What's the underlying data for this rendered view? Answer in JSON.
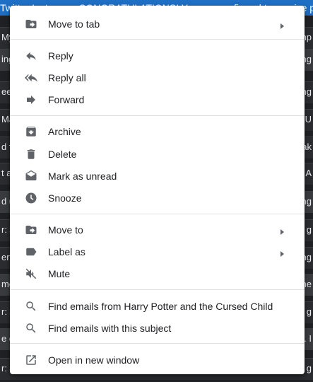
{
  "background": {
    "banner": "Twitter Instagram CONGRATULATIONS! You are confirmed to receive pr",
    "rows": [
      {
        "left": "My",
        "right": "mp"
      },
      {
        "left": "ing",
        "right": "ing"
      },
      {
        "left": "een",
        "right": "ing"
      },
      {
        "left": "Ma",
        "right": "XU"
      },
      {
        "left": "d f",
        "right": "ak"
      },
      {
        "left": "t a",
        "right": "A"
      },
      {
        "left": "d u",
        "right": "ng"
      },
      {
        "left": "r: J",
        "right": "g"
      },
      {
        "left": "erfe",
        "right": "ng"
      },
      {
        "left": "me",
        "right": "he"
      },
      {
        "left": "r: J",
        "right": "g"
      },
      {
        "left": "e c",
        "right": "s. I"
      },
      {
        "left": "r: J",
        "right": "g"
      }
    ]
  },
  "menu": {
    "groups": [
      [
        {
          "label": "Move to tab",
          "icon": "move-to-tab-icon",
          "submenu": true
        }
      ],
      [
        {
          "label": "Reply",
          "icon": "reply-icon"
        },
        {
          "label": "Reply all",
          "icon": "reply-all-icon"
        },
        {
          "label": "Forward",
          "icon": "forward-icon"
        }
      ],
      [
        {
          "label": "Archive",
          "icon": "archive-icon"
        },
        {
          "label": "Delete",
          "icon": "trash-icon"
        },
        {
          "label": "Mark as unread",
          "icon": "mark-unread-icon"
        },
        {
          "label": "Snooze",
          "icon": "snooze-clock-icon"
        }
      ],
      [
        {
          "label": "Move to",
          "icon": "move-to-icon",
          "submenu": true
        },
        {
          "label": "Label as",
          "icon": "label-icon",
          "submenu": true
        },
        {
          "label": "Mute",
          "icon": "mute-icon"
        }
      ],
      [
        {
          "label": "Find emails from Harry Potter and the Cursed Child",
          "icon": "search-icon"
        },
        {
          "label": "Find emails with this subject",
          "icon": "search-icon"
        }
      ],
      [
        {
          "label": "Open in new window",
          "icon": "open-new-window-icon"
        }
      ]
    ],
    "colors": {
      "icon": "#5f6368",
      "text": "#202124",
      "divider": "#e0e0e0"
    }
  }
}
